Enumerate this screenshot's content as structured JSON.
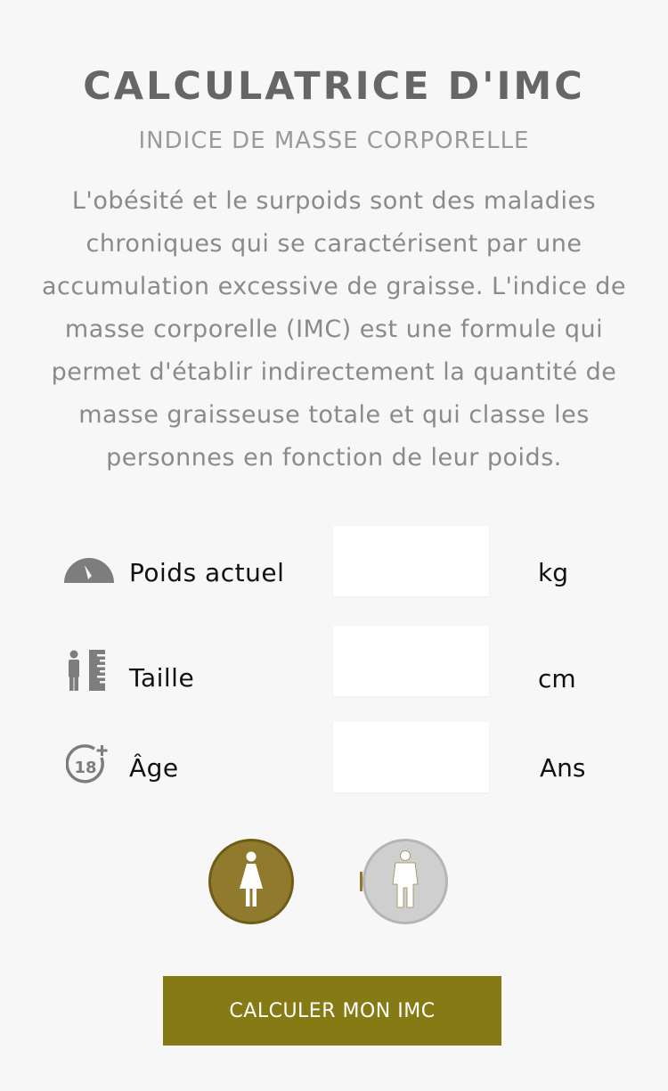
{
  "header": {
    "title": "CALCULATRICE D'IMC",
    "subtitle": "INDICE DE MASSE CORPORELLE",
    "description": "L'obésité et le surpoids sont des maladies chroniques qui se caractérisent par une accumulation excessive de graisse. L'indice de masse corporelle (IMC) est une formule qui permet d'établir indirectement la quantité de masse graisseuse totale et qui classe les personnes en fonction de leur poids."
  },
  "form": {
    "weight": {
      "label": "Poids actuel",
      "unit": "kg",
      "value": "",
      "icon": "scale-gauge-icon"
    },
    "height": {
      "label": "Taille",
      "unit": "cm",
      "value": "",
      "icon": "height-ruler-icon"
    },
    "age": {
      "label": "Âge",
      "unit": "Ans",
      "value": "",
      "icon": "age-18-plus-icon"
    }
  },
  "gender": {
    "selected": "female",
    "options": [
      {
        "id": "female",
        "icon": "female-person-icon"
      },
      {
        "id": "male",
        "icon": "male-person-icon"
      }
    ]
  },
  "actions": {
    "calculate_label": "CALCULER MON IMC"
  },
  "colors": {
    "background": "#f7f7f7",
    "title": "#666666",
    "accent_selected": "#8f7a2e",
    "unselected": "#cfcfcf",
    "button": "#857a13",
    "button_text": "#ffffff"
  }
}
